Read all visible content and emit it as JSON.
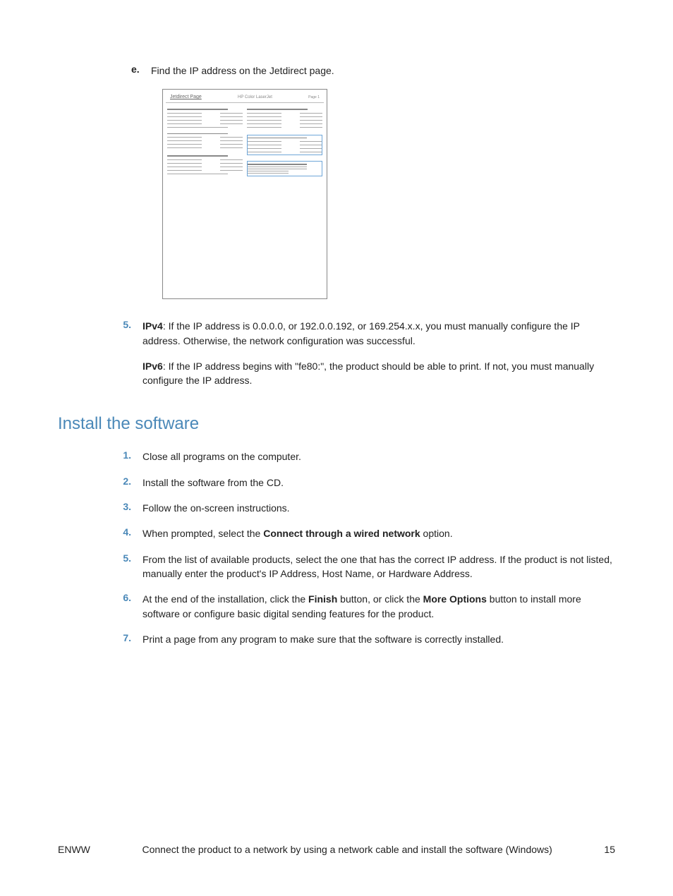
{
  "step_e": {
    "marker": "e.",
    "text": "Find the IP address on the Jetdirect page."
  },
  "jetdirect": {
    "title": "Jetdirect Page",
    "center": "HP Color LaserJet",
    "page": "Page 1"
  },
  "step5": {
    "marker": "5.",
    "ipv4_label": "IPv4",
    "ipv4_text": ": If the IP address is 0.0.0.0, or 192.0.0.192, or 169.254.x.x, you must manually configure the IP address. Otherwise, the network configuration was successful.",
    "ipv6_label": "IPv6",
    "ipv6_text": ": If the IP address begins with \"fe80:\", the product should be able to print. If not, you must manually configure the IP address."
  },
  "section_heading": "Install the software",
  "install": {
    "s1": {
      "marker": "1.",
      "text": "Close all programs on the computer."
    },
    "s2": {
      "marker": "2.",
      "text": "Install the software from the CD."
    },
    "s3": {
      "marker": "3.",
      "text": "Follow the on-screen instructions."
    },
    "s4": {
      "marker": "4.",
      "pre": "When prompted, select the ",
      "bold": "Connect through a wired network",
      "post": " option."
    },
    "s5": {
      "marker": "5.",
      "text": "From the list of available products, select the one that has the correct IP address. If the product is not listed, manually enter the product's IP Address, Host Name, or Hardware Address."
    },
    "s6": {
      "marker": "6.",
      "pre": "At the end of the installation, click the ",
      "b1": "Finish",
      "mid": " button, or click the ",
      "b2": "More Options",
      "post": " button to install more software or configure basic digital sending features for the product."
    },
    "s7": {
      "marker": "7.",
      "text": "Print a page from any program to make sure that the software is correctly installed."
    }
  },
  "footer": {
    "left": "ENWW",
    "center": "Connect the product to a network by using a network cable and install the software (Windows)",
    "right": "15"
  }
}
